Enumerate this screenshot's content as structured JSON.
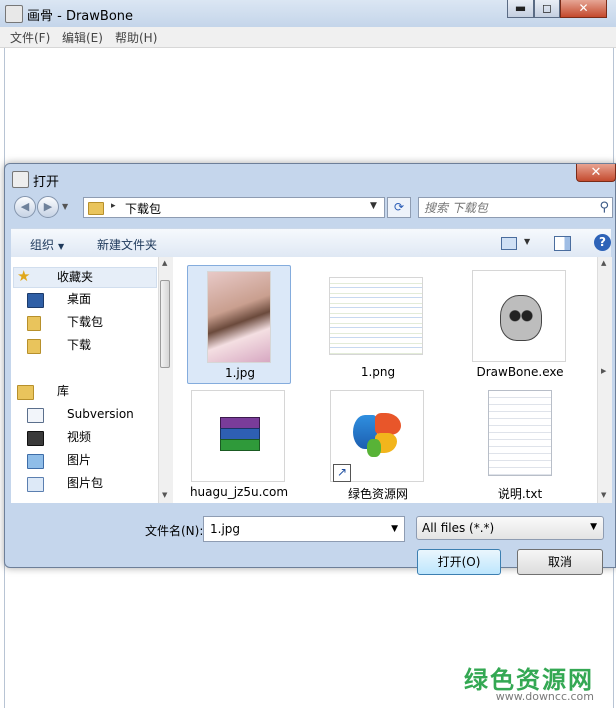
{
  "window": {
    "title": "画骨 - DrawBone",
    "controls": {
      "minimize": "▬",
      "maximize": "◻",
      "close": "✕"
    }
  },
  "menubar": {
    "items": [
      {
        "label": "文件(F)"
      },
      {
        "label": "编辑(E)"
      },
      {
        "label": "帮助(H)"
      }
    ]
  },
  "dialog": {
    "title": "打开",
    "close_glyph": "✕",
    "address": {
      "path": "下载包",
      "separator": "▸"
    },
    "search_placeholder": "搜索 下载包",
    "toolbar": {
      "organize": "组织",
      "new_folder": "新建文件夹"
    },
    "nav": {
      "items": [
        {
          "label": "收藏夹",
          "icon": "star-icon"
        },
        {
          "label": "桌面",
          "icon": "desktop-icon"
        },
        {
          "label": "下载包",
          "icon": "folder-icon"
        },
        {
          "label": "下载",
          "icon": "download-folder-icon"
        },
        {
          "label": "库",
          "icon": "library-icon"
        },
        {
          "label": "Subversion",
          "icon": "subversion-icon"
        },
        {
          "label": "视频",
          "icon": "video-icon"
        },
        {
          "label": "图片",
          "icon": "picture-icon"
        },
        {
          "label": "图片包",
          "icon": "picture-folder-icon"
        }
      ]
    },
    "files": [
      {
        "name": "1.jpg",
        "icon": "photo-thumbnail",
        "selected": true
      },
      {
        "name": "1.png",
        "icon": "webpage-screenshot-thumbnail",
        "selected": false
      },
      {
        "name": "DrawBone.exe",
        "icon": "skull-sketch-thumbnail",
        "selected": false
      },
      {
        "name": "huagu_jz5u.com",
        "icon": "winrar-archive-icon",
        "selected": false
      },
      {
        "name": "绿色资源网",
        "icon": "butterfly-shortcut-icon",
        "selected": false
      },
      {
        "name": "说明.txt",
        "icon": "text-document-icon",
        "selected": false
      }
    ],
    "filename_label": "文件名(N):",
    "filename_value": "1.jpg",
    "filetype_value": "All files (*.*)",
    "open_button": "打开(O)",
    "cancel_button": "取消"
  },
  "watermark": {
    "brand": "绿色资源网",
    "url": "www.downcc.com"
  }
}
